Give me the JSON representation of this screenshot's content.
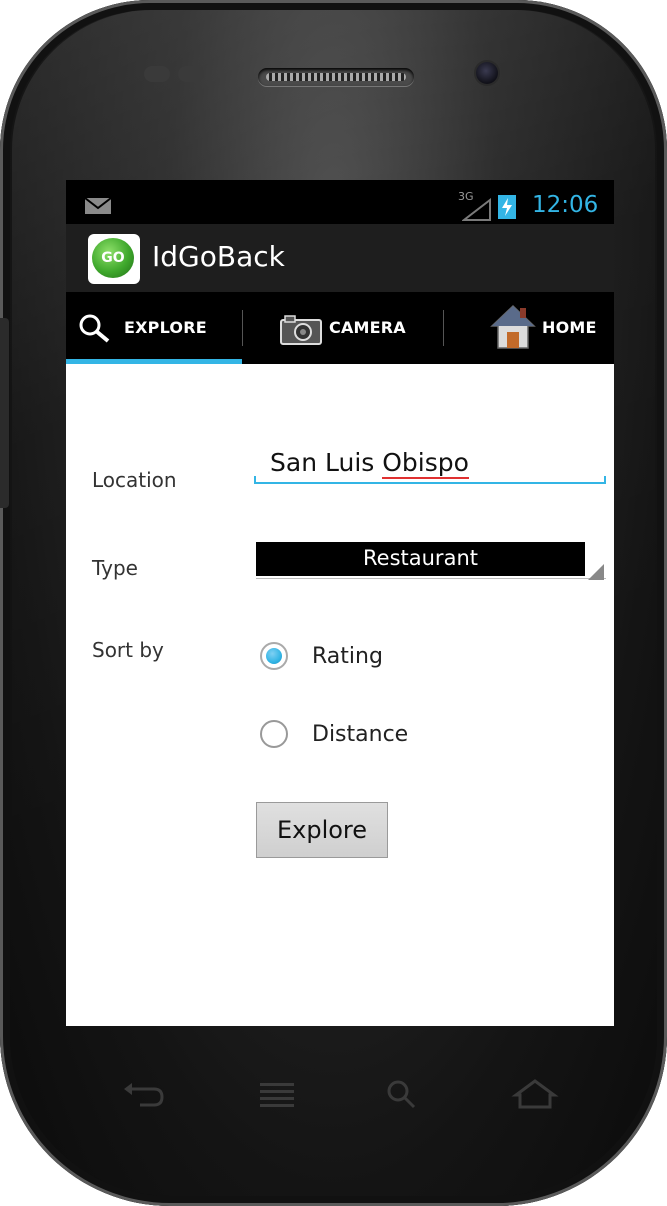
{
  "status_bar": {
    "time": "12:06",
    "signal_label": "3G"
  },
  "action_bar": {
    "app_icon_text": "GO",
    "title": "IdGoBack"
  },
  "tabs": [
    {
      "label": "EXPLORE",
      "icon": "search-icon",
      "selected": true
    },
    {
      "label": "CAMERA",
      "icon": "camera-icon",
      "selected": false
    },
    {
      "label": "HOME",
      "icon": "house-icon",
      "selected": false
    }
  ],
  "form": {
    "location_label": "Location",
    "location_value_a": "San Luis ",
    "location_value_b": "Obispo",
    "type_label": "Type",
    "type_value": "Restaurant",
    "sort_label": "Sort by",
    "sort_options": [
      {
        "label": "Rating",
        "checked": true
      },
      {
        "label": "Distance",
        "checked": false
      }
    ],
    "explore_button": "Explore"
  },
  "colors": {
    "accent": "#33b5e5",
    "action_bar": "#1e1e1e",
    "tab_bar": "#000000"
  }
}
